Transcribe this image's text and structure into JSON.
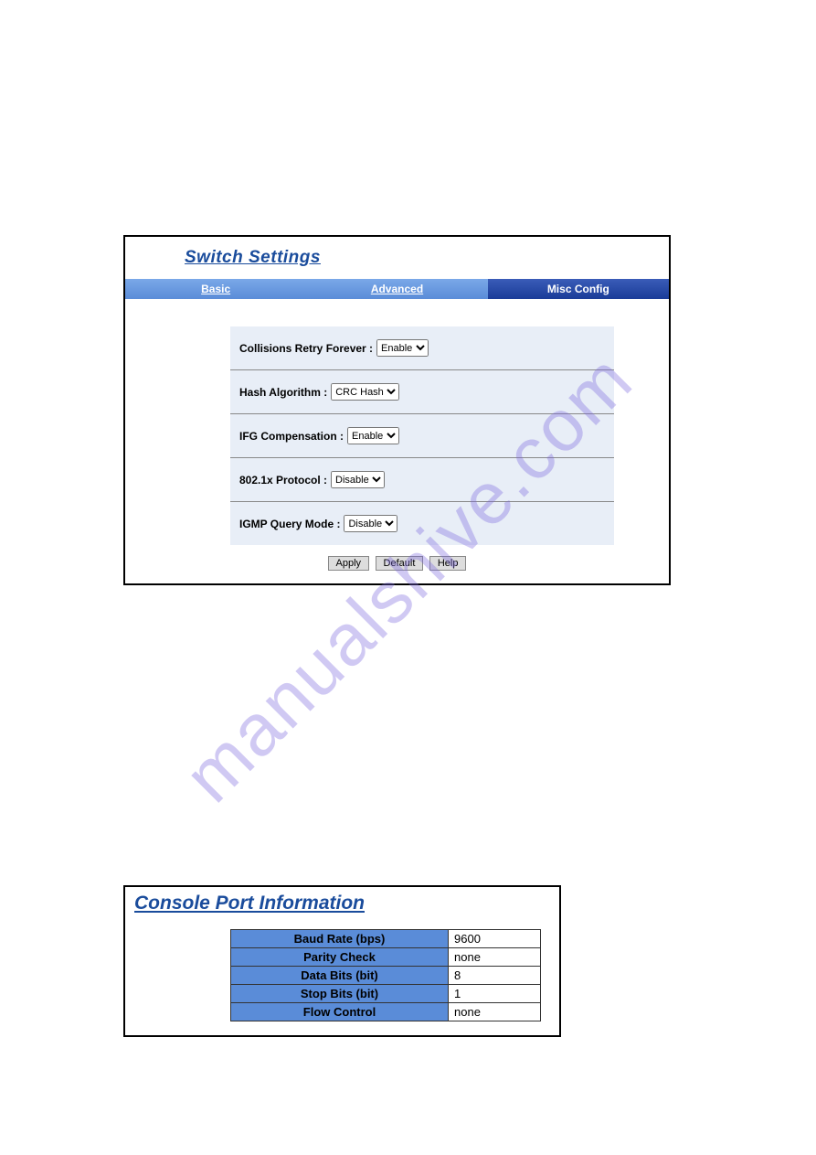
{
  "watermark": "manualshive.com",
  "panel1": {
    "title": "Switch Settings",
    "tabs": [
      {
        "label": "Basic",
        "active": false
      },
      {
        "label": "Advanced",
        "active": false
      },
      {
        "label": "Misc Config",
        "active": true
      }
    ],
    "rows": [
      {
        "label": "Collisions Retry Forever :",
        "value": "Enable"
      },
      {
        "label": "Hash Algorithm :",
        "value": "CRC Hash"
      },
      {
        "label": "IFG Compensation :",
        "value": "Enable"
      },
      {
        "label": "802.1x Protocol :",
        "value": "Disable"
      },
      {
        "label": "IGMP Query Mode :",
        "value": "Disable"
      }
    ],
    "buttons": {
      "apply": "Apply",
      "default": "Default",
      "help": "Help"
    }
  },
  "panel2": {
    "title": "Console Port Information",
    "rows": [
      {
        "label": "Baud Rate (bps)",
        "value": "9600"
      },
      {
        "label": "Parity Check",
        "value": "none"
      },
      {
        "label": "Data Bits (bit)",
        "value": "8"
      },
      {
        "label": "Stop Bits (bit)",
        "value": "1"
      },
      {
        "label": "Flow Control",
        "value": "none"
      }
    ]
  }
}
